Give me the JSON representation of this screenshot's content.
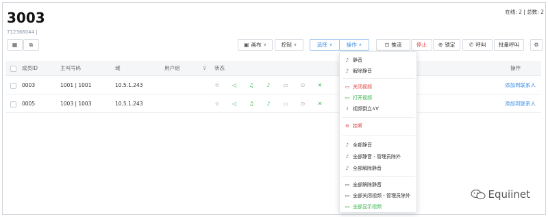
{
  "header": {
    "title": "3003",
    "subtitle": "712366044 |",
    "online_summary": "在线: 2 | 总数: 2"
  },
  "toolbar": {
    "canvas_label": "画布",
    "control_label": "控制",
    "select_label": "选择",
    "operate_label": "操作",
    "push_label": "推流",
    "stop_label": "停止",
    "lock_label": "锁定",
    "call_label": "呼叫",
    "batch_call_label": "批量呼叫"
  },
  "table": {
    "columns": [
      "成员ID",
      "主叫号码",
      "域",
      "用户组",
      "状态",
      "操作"
    ],
    "rows": [
      {
        "member_id": "0003",
        "caller": "1001 | 1001",
        "domain": "10.5.1.243",
        "group": "",
        "action": "添加到联系人"
      },
      {
        "member_id": "0005",
        "caller": "1003 | 1003",
        "domain": "10.5.1.243",
        "group": "",
        "action": "添加到联系人"
      }
    ]
  },
  "menu": {
    "items": [
      {
        "label": "静音",
        "icon": "mic-off-icon",
        "tone": "normal"
      },
      {
        "label": "解除静音",
        "icon": "mic-icon",
        "tone": "normal"
      },
      {
        "label": "关闭视频",
        "icon": "video-icon",
        "tone": "red"
      },
      {
        "label": "打开视频",
        "icon": "video-icon",
        "tone": "green"
      },
      {
        "label": "视频倒立∧∀",
        "icon": "flip-icon",
        "tone": "normal"
      },
      {
        "label": "挂断",
        "icon": "hangup-icon",
        "tone": "red"
      },
      {
        "label": "全部静音",
        "icon": "mic-off-icon",
        "tone": "normal"
      },
      {
        "label": "全部静音 - 管理员除外",
        "icon": "mic-off-icon",
        "tone": "normal"
      },
      {
        "label": "全部解除静音",
        "icon": "mic-icon",
        "tone": "normal"
      },
      {
        "label": "全部解除静音",
        "icon": "video-icon",
        "tone": "normal"
      },
      {
        "label": "全部关闭视频 - 管理员除外",
        "icon": "video-icon",
        "tone": "normal"
      },
      {
        "label": "全部显示视频",
        "icon": "video-icon",
        "tone": "green"
      }
    ]
  },
  "watermark": {
    "text": "Equiinet"
  },
  "colors": {
    "accent": "#3a8ee6",
    "danger": "#e23b3b",
    "success": "#35b34a"
  }
}
